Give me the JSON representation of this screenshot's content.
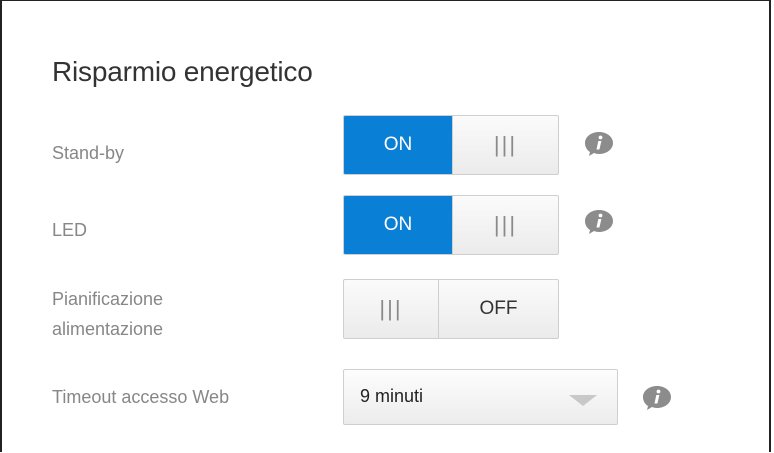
{
  "section": {
    "title": "Risparmio energetico"
  },
  "settings": {
    "standby": {
      "label": "Stand-by",
      "on_label": "ON",
      "grip": "|||"
    },
    "led": {
      "label": "LED",
      "on_label": "ON",
      "grip": "|||"
    },
    "schedule": {
      "label_line1": "Pianificazione",
      "label_line2": "alimentazione",
      "grip": "|||",
      "off_label": "OFF"
    },
    "timeout": {
      "label": "Timeout accesso Web",
      "value": "9 minuti"
    }
  },
  "icons": {
    "info": "info-icon",
    "dropdown": "chevron-down-icon"
  },
  "colors": {
    "accent": "#0a7fd6",
    "info_icon": "#8c8c8c",
    "label_text": "#878787"
  }
}
